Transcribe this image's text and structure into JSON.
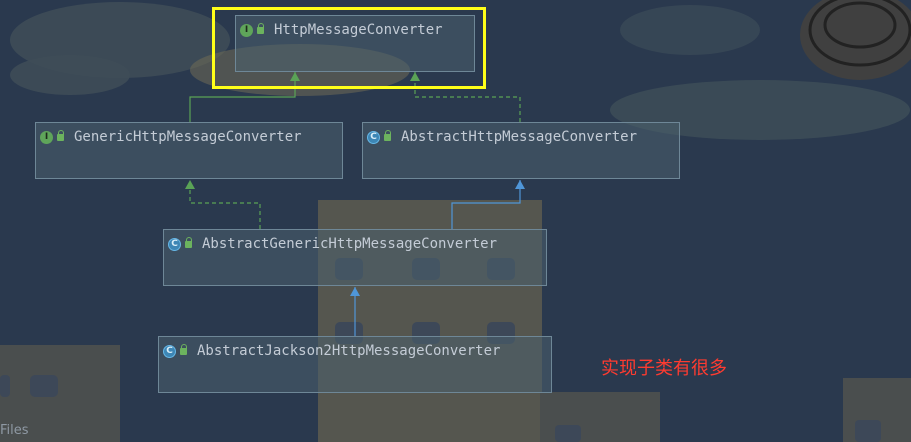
{
  "diagram": {
    "nodes": [
      {
        "id": "n1",
        "kind": "interface",
        "kind_letter": "I",
        "label": "HttpMessageConverter"
      },
      {
        "id": "n2",
        "kind": "interface",
        "kind_letter": "I",
        "label": "GenericHttpMessageConverter"
      },
      {
        "id": "n3",
        "kind": "abstract-class",
        "kind_letter": "C",
        "label": "AbstractHttpMessageConverter"
      },
      {
        "id": "n4",
        "kind": "abstract-class",
        "kind_letter": "C",
        "label": "AbstractGenericHttpMessageConverter"
      },
      {
        "id": "n5",
        "kind": "abstract-class",
        "kind_letter": "C",
        "label": "AbstractJackson2HttpMessageConverter"
      }
    ],
    "edges": [
      {
        "from": "n2",
        "to": "n1",
        "type": "extends",
        "style": "solid",
        "color": "#5aa356"
      },
      {
        "from": "n3",
        "to": "n1",
        "type": "implements",
        "style": "dashed",
        "color": "#5aa356"
      },
      {
        "from": "n4",
        "to": "n2",
        "type": "implements",
        "style": "dashed",
        "color": "#5aa356"
      },
      {
        "from": "n4",
        "to": "n3",
        "type": "extends",
        "style": "solid",
        "color": "#4f96d8"
      },
      {
        "from": "n5",
        "to": "n4",
        "type": "extends",
        "style": "solid",
        "color": "#4f96d8"
      }
    ],
    "highlighted_node": "n1",
    "highlight_color": "#ffff19"
  },
  "annotation": {
    "text": "实现子类有很多",
    "color": "#ff3b30"
  },
  "footer": {
    "files_label": "Files"
  }
}
